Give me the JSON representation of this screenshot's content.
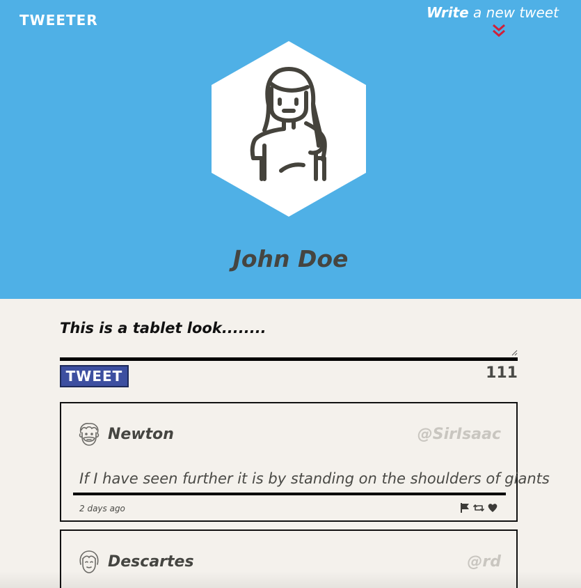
{
  "nav": {
    "brand": "TWEETER",
    "compose_strong": "Write",
    "compose_rest": " a new tweet"
  },
  "profile": {
    "name": "John Doe"
  },
  "composer": {
    "value": "This is a tablet look........",
    "submit_label": "TWEET",
    "counter": "111"
  },
  "tweets": [
    {
      "name": "Newton",
      "handle": "@SirIsaac",
      "content": "If I have seen further it is by standing on the shoulders of giants",
      "time": "2 days ago",
      "avatar_icon": "bearded-man-avatar-icon"
    },
    {
      "name": "Descartes",
      "handle": "@rd",
      "avatar_icon": "woman-avatar-icon"
    }
  ],
  "icons": {
    "chevron": "double-chevron-down-icon",
    "flag": "flag-icon",
    "retweet": "retweet-icon",
    "like": "heart-icon"
  },
  "colors": {
    "header_bg": "#4fb0e6",
    "page_bg": "#f4f1ec",
    "button_bg": "#3d4fa0",
    "accent_red": "#d0203a",
    "handle_gray": "#c9c6c0"
  }
}
